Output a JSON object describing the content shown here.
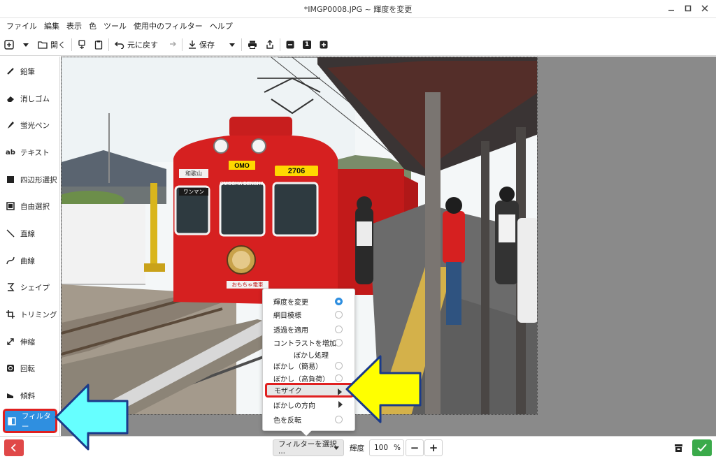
{
  "window": {
    "title": "*IMGP0008.JPG ~ 輝度を変更"
  },
  "menubar": [
    "ファイル",
    "編集",
    "表示",
    "色",
    "ツール",
    "使用中のフィルター",
    "ヘルプ"
  ],
  "toolbar": {
    "open_label": "開く",
    "undo_label": "元に戻す",
    "save_label": "保存",
    "zoom_value": "1"
  },
  "sidebar": {
    "tools": [
      {
        "label": "鉛筆",
        "icon": "pencil-icon"
      },
      {
        "label": "消しゴム",
        "icon": "eraser-icon"
      },
      {
        "label": "蛍光ペン",
        "icon": "highlighter-icon"
      },
      {
        "label": "テキスト",
        "icon": "text-icon"
      },
      {
        "label": "四辺形選択",
        "icon": "rect-select-icon"
      },
      {
        "label": "自由選択",
        "icon": "free-select-icon"
      },
      {
        "label": "直線",
        "icon": "line-icon"
      },
      {
        "label": "曲線",
        "icon": "curve-icon"
      },
      {
        "label": "シェイプ",
        "icon": "shape-icon"
      },
      {
        "label": "トリミング",
        "icon": "crop-icon"
      },
      {
        "label": "伸縮",
        "icon": "scale-icon"
      },
      {
        "label": "回転",
        "icon": "rotate-icon"
      },
      {
        "label": "傾斜",
        "icon": "skew-icon"
      },
      {
        "label": "フィルター",
        "icon": "filter-icon"
      }
    ],
    "active": "フィルター"
  },
  "photo": {
    "front_sign": "OMO",
    "car_number": "2706",
    "dest_sign": "和歌山",
    "oneman_sign": "ワンマン",
    "train_name": "OMOCHA DENSHA",
    "side_text": "おもちゃ電車"
  },
  "filter_menu": {
    "options": [
      {
        "label": "輝度を変更",
        "control": "radio-on"
      },
      {
        "label": "網目模様",
        "control": "radio"
      },
      {
        "label": "透過を適用",
        "control": "radio"
      },
      {
        "label": "コントラストを増加",
        "control": "radio"
      },
      {
        "label": "ぼかし処理",
        "control": "none"
      },
      {
        "label": "ぼかし（簡易）",
        "control": "radio"
      },
      {
        "label": "ぼかし（高負荷）",
        "control": "radio"
      },
      {
        "label": "モザイク",
        "control": "submenu"
      },
      {
        "label": "ぼかしの方向",
        "control": "submenu"
      },
      {
        "label": "色を反転",
        "control": "radio"
      }
    ],
    "highlighted": "モザイク"
  },
  "bottombar": {
    "filter_select_label": "フィルターを選択···",
    "brightness_label": "輝度",
    "brightness_value": "100",
    "percent_unit": "%",
    "minus": "−",
    "plus": "+"
  },
  "colors": {
    "accent_blue": "#2f8fe0",
    "highlight_red": "#e02020",
    "back_red": "#e04848",
    "ok_green": "#3aaa4a",
    "callout_cyan": "#66ffff",
    "callout_yellow": "#ffff00",
    "train_red": "#d62020"
  }
}
